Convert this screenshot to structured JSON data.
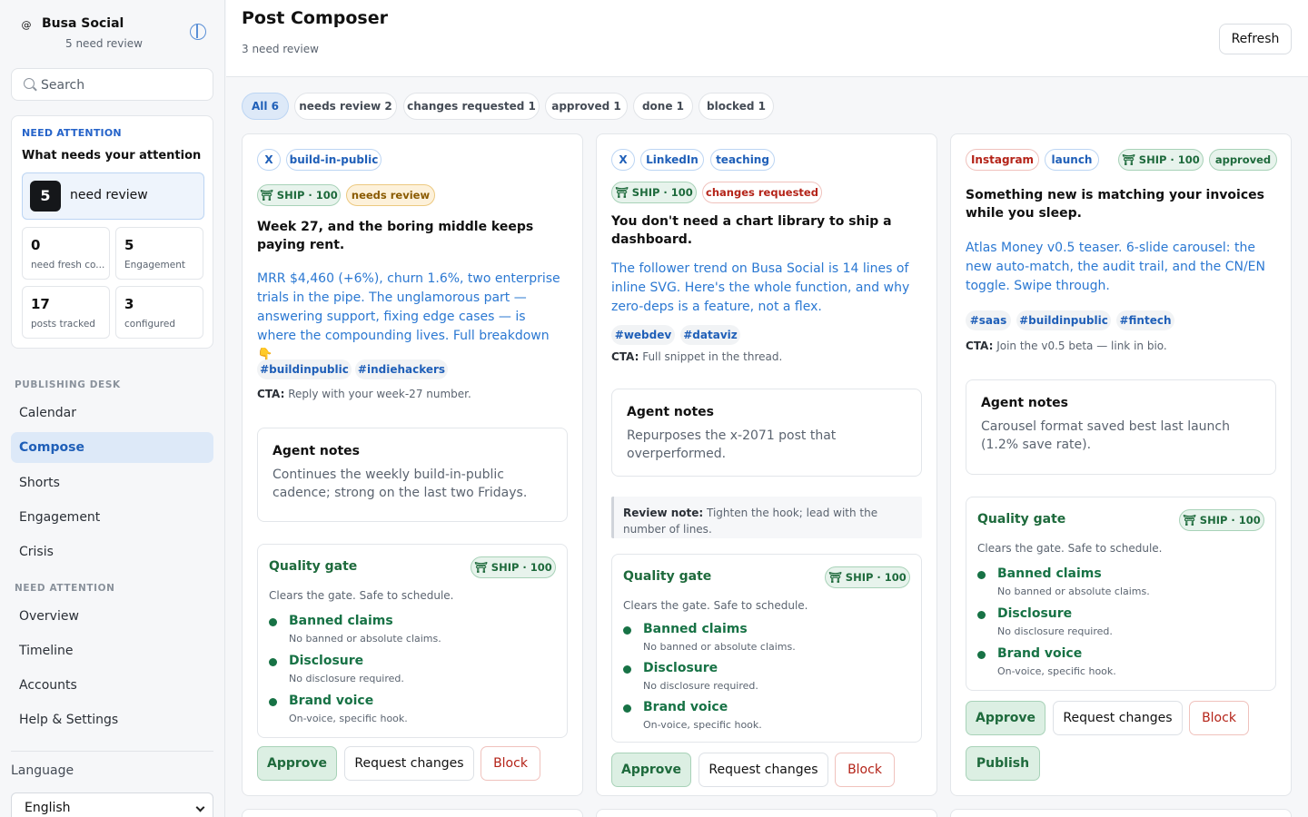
{
  "sidebar": {
    "brand_logo": "@",
    "brand_name": "Busa Social",
    "brand_sub": "5 need review",
    "search_placeholder": "Search",
    "attention": {
      "eyebrow": "NEED ATTENTION",
      "title": "What needs your attention",
      "main_count": "5",
      "main_label": "need review",
      "stats": [
        {
          "num": "0",
          "label": "need fresh co..."
        },
        {
          "num": "5",
          "label": "Engagement"
        },
        {
          "num": "17",
          "label": "posts tracked"
        },
        {
          "num": "3",
          "label": "configured"
        }
      ]
    },
    "section1": "PUBLISHING DESK",
    "nav1": [
      "Calendar",
      "Compose",
      "Shorts",
      "Engagement",
      "Crisis"
    ],
    "section2": "NEED ATTENTION",
    "nav2": [
      "Overview",
      "Timeline",
      "Accounts",
      "Help & Settings"
    ],
    "language_label": "Language",
    "language_value": "English"
  },
  "header": {
    "title": "Post Composer",
    "subtitle": "3 need review",
    "refresh": "Refresh"
  },
  "filters": [
    "All 6",
    "needs review 2",
    "changes requested 1",
    "approved 1",
    "done 1",
    "blocked 1"
  ],
  "cards": [
    {
      "tags": [
        "X",
        "build-in-public"
      ],
      "ship": "⛩ SHIP · 100",
      "status": "needs review",
      "title": "Week 27, and the boring middle keeps paying rent.",
      "body": "MRR $4,460 (+6%), churn 1.6%, two enterprise trials in the pipe. The unglamorous part — answering support, fixing edge cases — is where the compounding lives. Full breakdown 👇",
      "hashtags": [
        "#buildinpublic",
        "#indiehackers"
      ],
      "cta_label": "CTA:",
      "cta": "Reply with your week-27 number.",
      "notes_title": "Agent notes",
      "notes": "Continues the weekly build-in-public cadence; strong on the last two Fridays.",
      "gate_title": "Quality gate",
      "gate_pill": "⛩ SHIP · 100",
      "gate_sub": "Clears the gate. Safe to schedule.",
      "gate_items": [
        {
          "h": "Banned claims",
          "s": "No banned or absolute claims."
        },
        {
          "h": "Disclosure",
          "s": "No disclosure required."
        },
        {
          "h": "Brand voice",
          "s": "On-voice, specific hook."
        }
      ],
      "approve": "Approve",
      "request": "Request changes",
      "block": "Block"
    },
    {
      "tags": [
        "X",
        "LinkedIn",
        "teaching"
      ],
      "ship": "⛩ SHIP · 100",
      "status": "changes requested",
      "title": "You don't need a chart library to ship a dashboard.",
      "body": "The follower trend on Busa Social is 14 lines of inline SVG. Here's the whole function, and why zero-deps is a feature, not a flex.",
      "hashtags": [
        "#webdev",
        "#dataviz"
      ],
      "cta_label": "CTA:",
      "cta": "Full snippet in the thread.",
      "notes_title": "Agent notes",
      "notes": "Repurposes the x-2071 post that overperformed.",
      "review_label": "Review note:",
      "review": "Tighten the hook; lead with the number of lines.",
      "gate_title": "Quality gate",
      "gate_pill": "⛩ SHIP · 100",
      "gate_sub": "Clears the gate. Safe to schedule.",
      "gate_items": [
        {
          "h": "Banned claims",
          "s": "No banned or absolute claims."
        },
        {
          "h": "Disclosure",
          "s": "No disclosure required."
        },
        {
          "h": "Brand voice",
          "s": "On-voice, specific hook."
        }
      ],
      "approve": "Approve",
      "request": "Request changes",
      "block": "Block"
    },
    {
      "tags": [
        "Instagram",
        "launch"
      ],
      "ship": "⛩ SHIP · 100",
      "status": "approved",
      "title": "Something new is matching your invoices while you sleep.",
      "body": "Atlas Money v0.5 teaser. 6-slide carousel: the new auto-match, the audit trail, and the CN/EN toggle. Swipe through.",
      "hashtags": [
        "#saas",
        "#buildinpublic",
        "#fintech"
      ],
      "cta_label": "CTA:",
      "cta": "Join the v0.5 beta — link in bio.",
      "notes_title": "Agent notes",
      "notes": "Carousel format saved best last launch (1.2% save rate).",
      "gate_title": "Quality gate",
      "gate_pill": "⛩ SHIP · 100",
      "gate_sub": "Clears the gate. Safe to schedule.",
      "gate_items": [
        {
          "h": "Banned claims",
          "s": "No banned or absolute claims."
        },
        {
          "h": "Disclosure",
          "s": "No disclosure required."
        },
        {
          "h": "Brand voice",
          "s": "On-voice, specific hook."
        }
      ],
      "approve": "Approve",
      "request": "Request changes",
      "block": "Block",
      "publish": "Publish"
    }
  ],
  "colors": {
    "accent": "#1f5fb8",
    "ship_green": "#1e6a3c",
    "block_red": "#b42318",
    "body_link": "#2b78d2"
  }
}
